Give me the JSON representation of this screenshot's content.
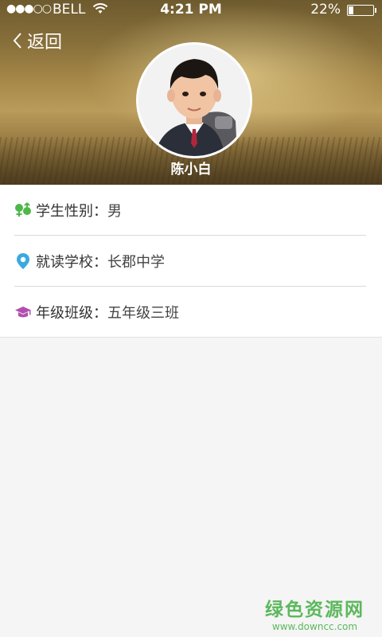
{
  "status_bar": {
    "signal": "●●●○○",
    "carrier": "BELL",
    "time": "4:21 PM",
    "battery_percent": "22%",
    "battery_level": 0.22
  },
  "nav": {
    "back_label": "返回"
  },
  "profile": {
    "name": "陈小白"
  },
  "info": [
    {
      "label": "学生性别",
      "separator": "：",
      "value": "男",
      "icon": "gender-icon",
      "color": "#4cb848"
    },
    {
      "label": "就读学校",
      "separator": "：",
      "value": "长郡中学",
      "icon": "location-pin-icon",
      "color": "#3aa9e0"
    },
    {
      "label": "年级班级",
      "separator": "：",
      "value": "五年级三班",
      "icon": "graduation-cap-icon",
      "color": "#b04fb0"
    }
  ],
  "watermark": {
    "title": "绿色资源网",
    "url": "www.downcc.com"
  }
}
